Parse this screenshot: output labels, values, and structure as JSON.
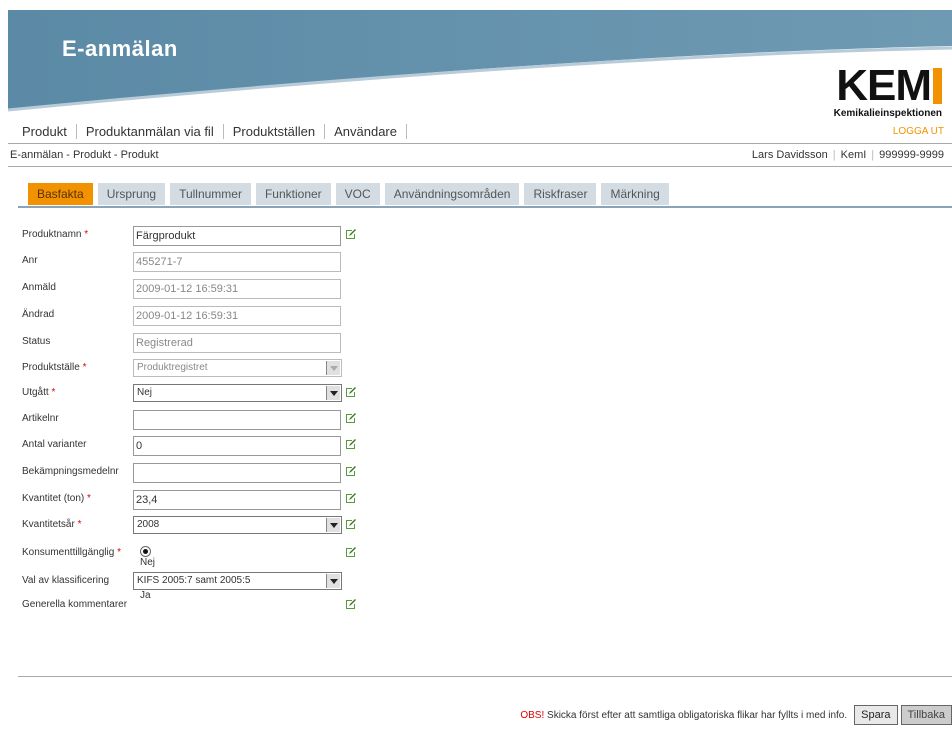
{
  "header": {
    "title": "E-anmälan",
    "logo_text": "KEM",
    "logo_subtitle": "Kemikalieinspektionen"
  },
  "nav": {
    "items": [
      "Produkt",
      "Produktanmälan via fil",
      "Produktställen",
      "Användare"
    ],
    "logout": "LOGGA UT"
  },
  "breadcrumb": "E-anmälan - Produkt - Produkt",
  "user": {
    "name": "Lars Davidsson",
    "org": "KemI",
    "number": "999999-9999"
  },
  "tabs": [
    "Basfakta",
    "Ursprung",
    "Tullnummer",
    "Funktioner",
    "VOC",
    "Användningsområden",
    "Riskfraser",
    "Märkning"
  ],
  "form": {
    "produktnamn": {
      "label": "Produktnamn",
      "value": "Färgprodukt"
    },
    "anr": {
      "label": "Anr",
      "value": "455271-7"
    },
    "anmald": {
      "label": "Anmäld",
      "value": "2009-01-12 16:59:31"
    },
    "andrad": {
      "label": "Ändrad",
      "value": "2009-01-12 16:59:31"
    },
    "status": {
      "label": "Status",
      "value": "Registrerad"
    },
    "produktstalle": {
      "label": "Produktställe",
      "value": "Produktregistret"
    },
    "utgatt": {
      "label": "Utgått",
      "value": "Nej"
    },
    "artikelnr": {
      "label": "Artikelnr",
      "value": ""
    },
    "antal_varianter": {
      "label": "Antal varianter",
      "value": "0"
    },
    "bekampningsmedelnr": {
      "label": "Bekämpningsmedelnr",
      "value": ""
    },
    "kvantitet": {
      "label": "Kvantitet (ton)",
      "value": "23,4"
    },
    "kvantitetsar": {
      "label": "Kvantitetsår",
      "value": "2008"
    },
    "konsument": {
      "label": "Konsumenttillgänglig",
      "opt_nej": "Nej",
      "opt_ja": "Ja",
      "selected": "Nej"
    },
    "klassificering": {
      "label": "Val av klassificering",
      "value": "KIFS 2005:7 samt 2005:5"
    },
    "kommentarer": {
      "label": "Generella kommentarer"
    },
    "required_mark": "*"
  },
  "footer": {
    "obs": "OBS!",
    "note": " Skicka först efter att samtliga obligatoriska flikar har fyllts i med info.",
    "save": "Spara",
    "back": "Tillbaka"
  },
  "colors": {
    "header_blue": "#5b8aa6",
    "accent_orange": "#f39200",
    "tab_inactive": "#d4dce3"
  }
}
